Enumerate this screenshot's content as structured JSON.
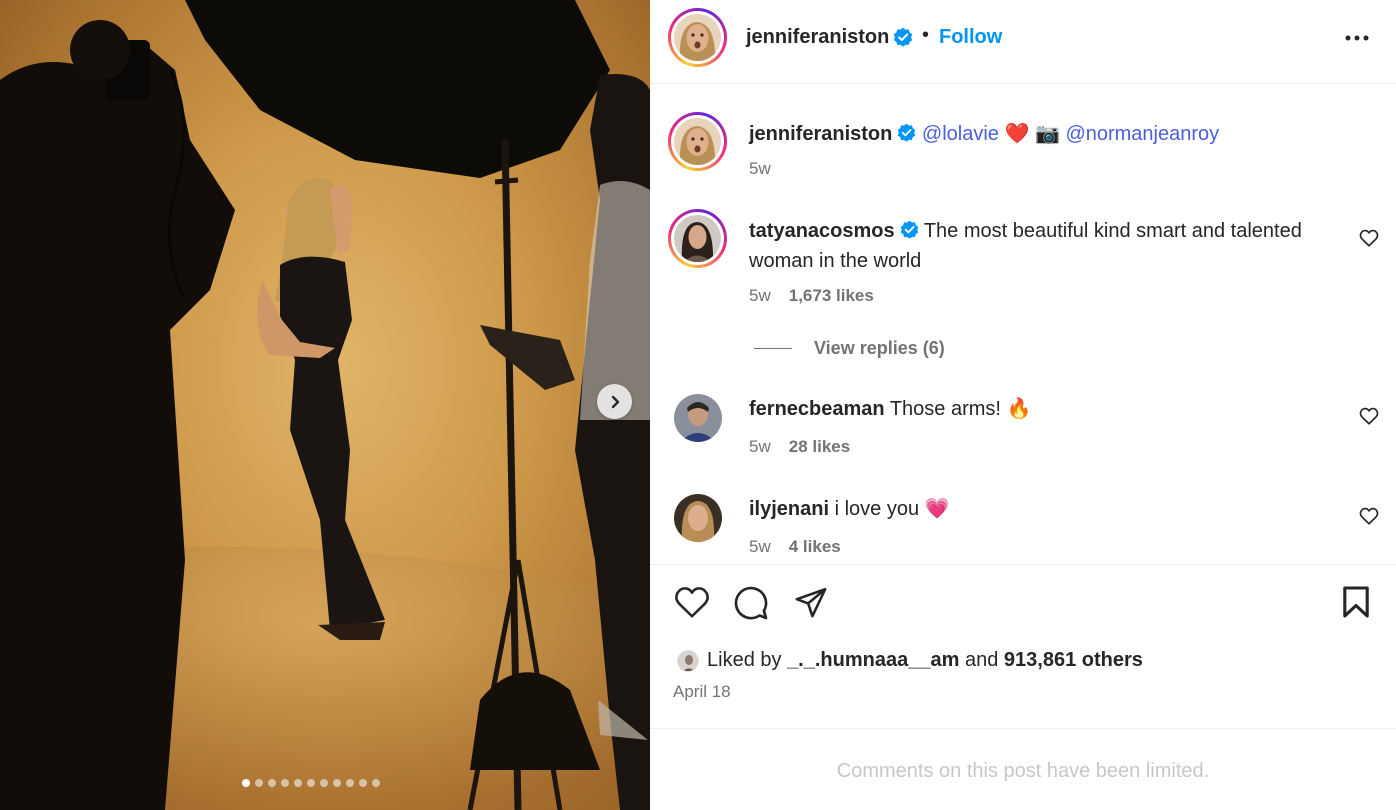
{
  "post": {
    "author": "jenniferaniston",
    "follow_label": "Follow",
    "bullet": "•",
    "more_icon": "more-horizontal-icon",
    "carousel": {
      "total_slides": 11,
      "active_slide": 1,
      "next_icon": "chevron-right-icon"
    }
  },
  "caption": {
    "username": "jenniferaniston",
    "mention1": "@lolavie",
    "emoji1": "❤️",
    "emoji2": "📷",
    "mention2": "@normanjeanroy",
    "time": "5w"
  },
  "comments": [
    {
      "username": "tatyanacosmos",
      "verified": true,
      "text": "The most beautiful kind smart and talented woman in the world",
      "time": "5w",
      "likes": "1,673 likes",
      "replies": "View replies (6)"
    },
    {
      "username": "fernecbeaman",
      "verified": false,
      "text": "Those arms! 🔥",
      "time": "5w",
      "likes": "28 likes"
    },
    {
      "username": "ilyjenani",
      "verified": false,
      "text": "i love you 💗",
      "time": "5w",
      "likes": "4 likes"
    }
  ],
  "actions": {
    "like_icon": "heart-icon",
    "comment_icon": "comment-icon",
    "share_icon": "send-icon",
    "save_icon": "bookmark-icon"
  },
  "likes_summary": {
    "prefix": "Liked by",
    "user": "_._.humnaaa__am",
    "middle": "and",
    "count": "913,861 others"
  },
  "date": "April 18",
  "comments_notice": "Comments on this post have been limited.",
  "colors": {
    "link": "#0095f6",
    "mention": "#4a5fdc",
    "verified": "#0095f6",
    "muted": "#737373"
  }
}
